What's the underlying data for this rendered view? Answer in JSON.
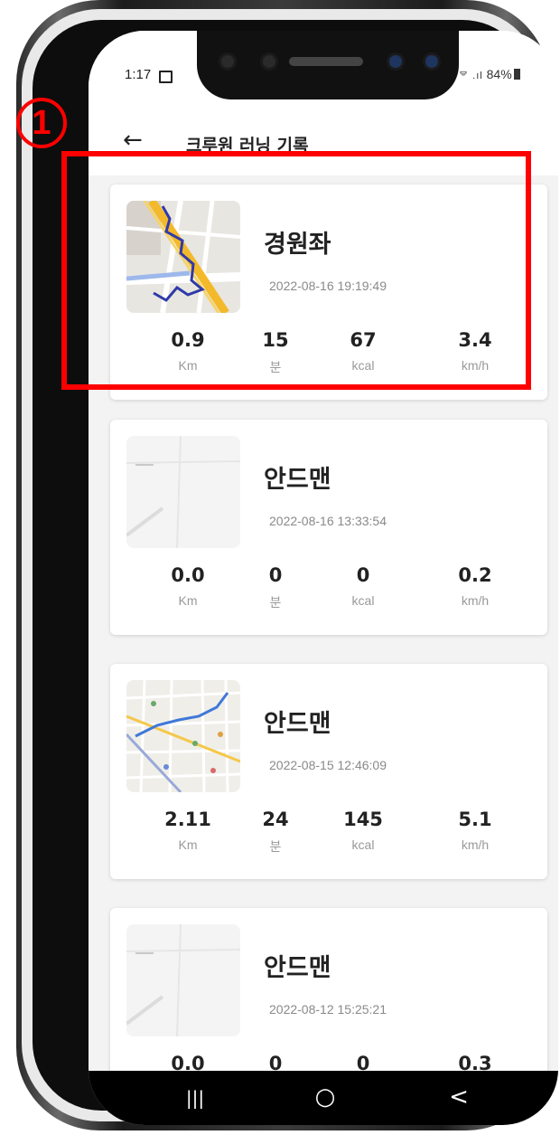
{
  "status_bar": {
    "time": "1:17",
    "signal_battery": "ᄄᄅ .ıl 84%"
  },
  "header": {
    "back_icon": "left-arrow-icon",
    "title": "크루원 러닝 기록"
  },
  "runs": [
    {
      "name": "경원좌",
      "date": "2022-08-16 19:19:49",
      "distance": "0.9",
      "minutes": "15",
      "calories": "67",
      "speed": "3.4",
      "map": "route-map"
    },
    {
      "name": "안드맨",
      "date": "2022-08-16 13:33:54",
      "distance": "0.0",
      "minutes": "0",
      "calories": "0",
      "speed": "0.2",
      "map": "blank-map"
    },
    {
      "name": "안드맨",
      "date": "2022-08-15 12:46:09",
      "distance": "2.11",
      "minutes": "24",
      "calories": "145",
      "speed": "5.1",
      "map": "dense-route-map"
    },
    {
      "name": "안드맨",
      "date": "2022-08-12 15:25:21",
      "distance": "0.0",
      "minutes": "0",
      "calories": "0",
      "speed": "0.3",
      "map": "blank-map"
    }
  ],
  "units": {
    "distance": "Km",
    "minutes": "분",
    "calories": "kcal",
    "speed": "km/h"
  },
  "nav": {
    "recents": "|||",
    "home": "○",
    "back": "<"
  },
  "annotation": {
    "step_number": "1",
    "highlight_color": "#ff0000"
  }
}
